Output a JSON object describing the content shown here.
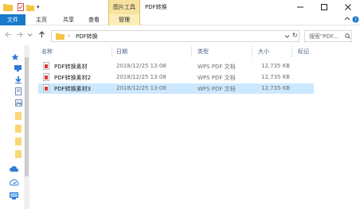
{
  "title_bar": {
    "context_tab": "图片工具",
    "window_title": "PDF转换",
    "qat_arrow": "▾"
  },
  "ribbon": {
    "tabs": [
      "文件",
      "主页",
      "共享",
      "查看",
      "管理"
    ]
  },
  "address": {
    "path": "PDF转换",
    "search_placeholder": "搜索\"PDF...",
    "refresh": "↻"
  },
  "columns": [
    "名称",
    "日期",
    "类型",
    "大小",
    "标记"
  ],
  "files": [
    {
      "name": "PDF转换素材",
      "date": "2018/12/25 13:08",
      "type": "WPS PDF 文档",
      "size": "12,735 KB",
      "selected": false
    },
    {
      "name": "PDF转换素材2",
      "date": "2018/12/25 13:08",
      "type": "WPS PDF 文档",
      "size": "12,735 KB",
      "selected": false
    },
    {
      "name": "PDF转换素材3",
      "date": "2018/12/25 13:08",
      "type": "WPS PDF 文档",
      "size": "12,735 KB",
      "selected": true
    }
  ],
  "colors": {
    "file_tab": "#1979ca",
    "selection": "#cce8ff",
    "context_tab": "#f7e3a0"
  }
}
